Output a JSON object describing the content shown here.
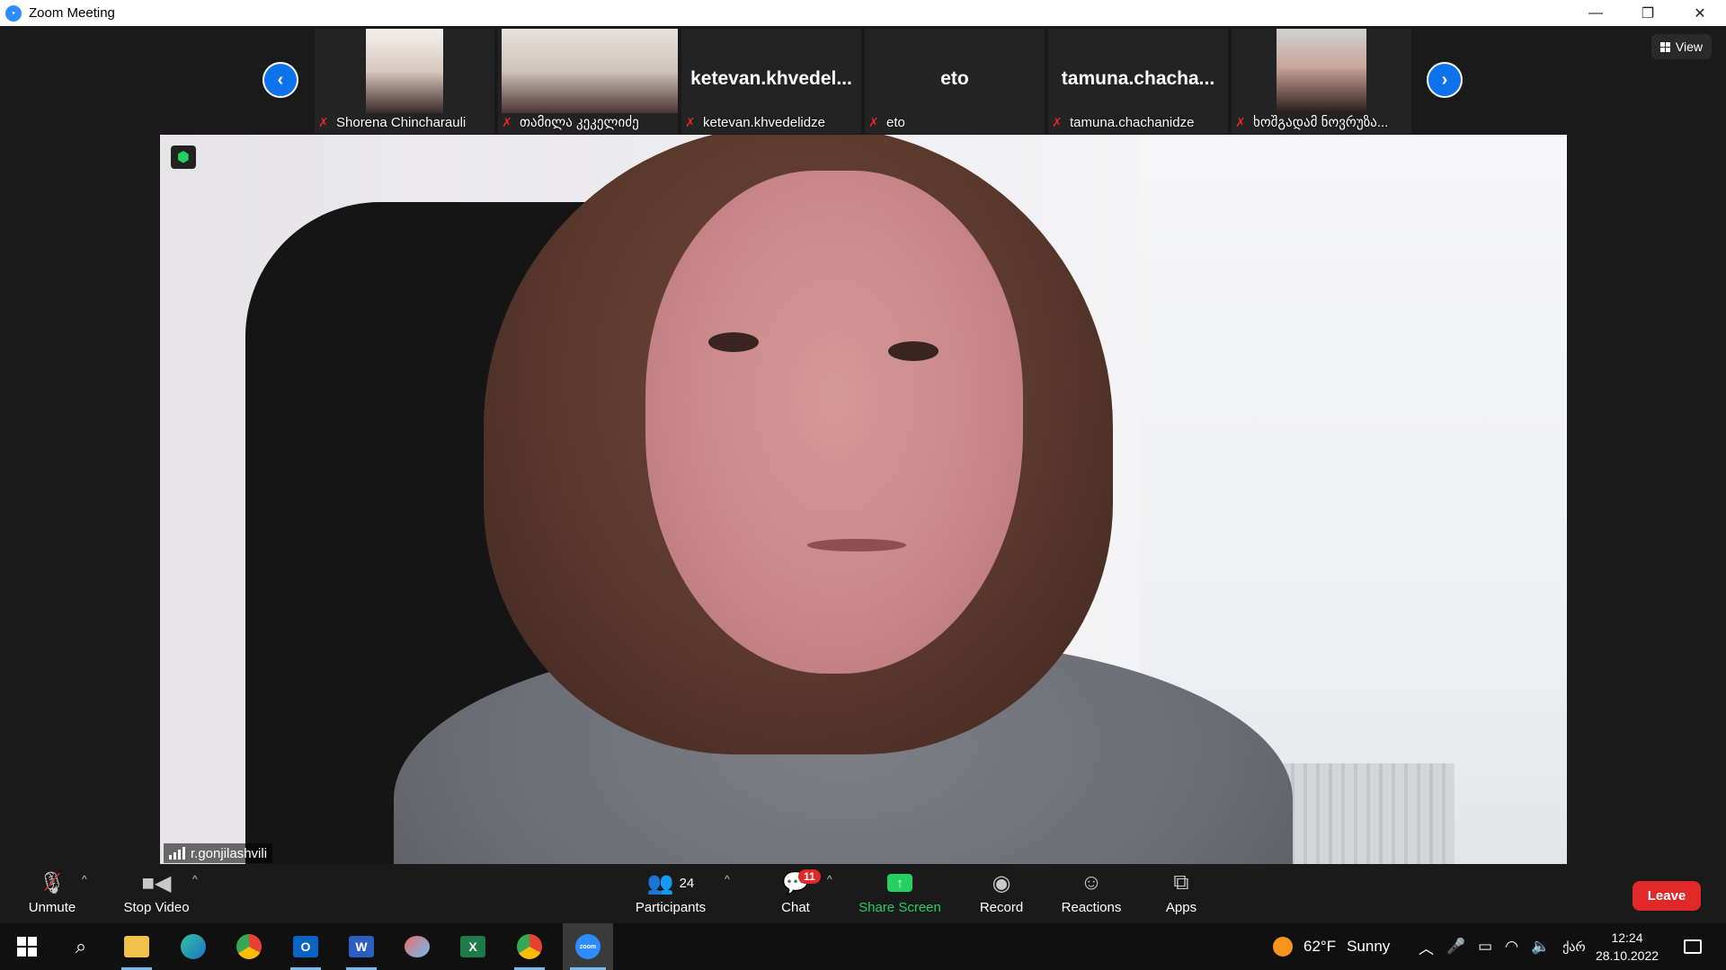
{
  "window": {
    "title": "Zoom Meeting",
    "minimize_glyph": "—",
    "restore_glyph": "❐",
    "close_glyph": "✕"
  },
  "gallery": {
    "prev_arrow": "‹",
    "next_arrow": "›",
    "thumbnails": [
      {
        "name": "Shorena Chincharauli",
        "big_name": ""
      },
      {
        "name": "თამილა კეკელიძე",
        "big_name": ""
      },
      {
        "name": "ketevan.khvedelidze",
        "big_name": "ketevan.khvedel..."
      },
      {
        "name": "eto",
        "big_name": "eto"
      },
      {
        "name": "tamuna.chachanidze",
        "big_name": "tamuna.chacha..."
      },
      {
        "name": "ხოშგადამ ნოვრუზა...",
        "big_name": ""
      }
    ]
  },
  "view_button": {
    "label": "View"
  },
  "main_video": {
    "speaker": "r.gonjilashvili"
  },
  "toolbar": {
    "unmute": "Unmute",
    "stop_video": "Stop Video",
    "participants": "Participants",
    "participants_count": "24",
    "chat": "Chat",
    "chat_badge": "11",
    "share_screen": "Share Screen",
    "record": "Record",
    "reactions": "Reactions",
    "apps": "Apps",
    "leave": "Leave",
    "accent_share": "#23d160",
    "accent_leave": "#e02828"
  },
  "taskbar": {
    "weather_temp": "62°F",
    "weather_desc": "Sunny",
    "language": "ქარ",
    "time": "12:24",
    "date": "28.10.2022",
    "zoom_label": "zoom"
  }
}
